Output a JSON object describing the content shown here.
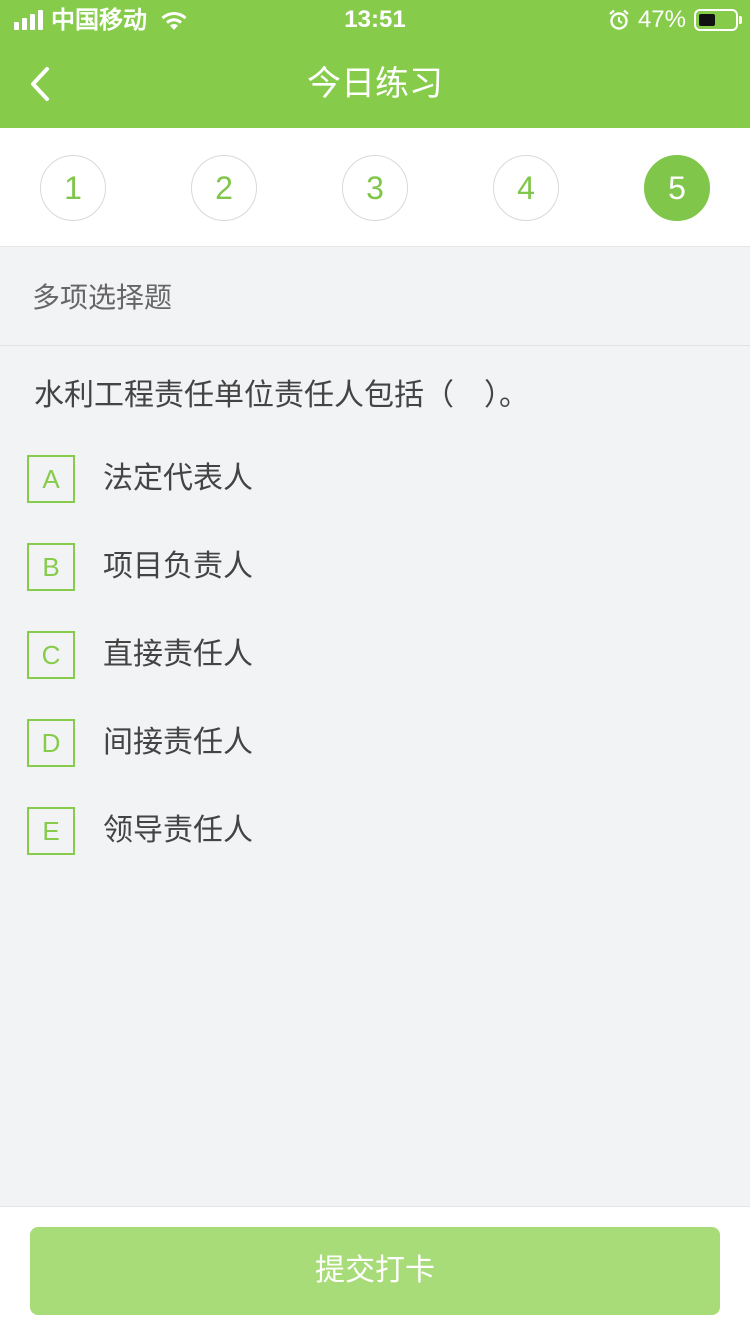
{
  "colors": {
    "brand": "#86cc4a",
    "accent": "#7fc64a",
    "button": "#a8dc78",
    "background": "#f2f3f5"
  },
  "status_bar": {
    "carrier": "中国移动",
    "time": "13:51",
    "battery": "47%",
    "icons": [
      "signal-icon",
      "wifi-icon",
      "alarm-icon",
      "battery-icon"
    ]
  },
  "nav": {
    "back_icon": "chevron-left-icon",
    "title": "今日练习"
  },
  "questions": {
    "numbers": [
      "1",
      "2",
      "3",
      "4",
      "5"
    ],
    "current": "5"
  },
  "question": {
    "type": "多项选择题",
    "text": "水利工程责任单位责任人包括（　）。",
    "options": [
      {
        "letter": "A",
        "text": "法定代表人"
      },
      {
        "letter": "B",
        "text": "项目负责人"
      },
      {
        "letter": "C",
        "text": "直接责任人"
      },
      {
        "letter": "D",
        "text": "间接责任人"
      },
      {
        "letter": "E",
        "text": "领导责任人"
      }
    ]
  },
  "footer": {
    "submit_label": "提交打卡"
  }
}
